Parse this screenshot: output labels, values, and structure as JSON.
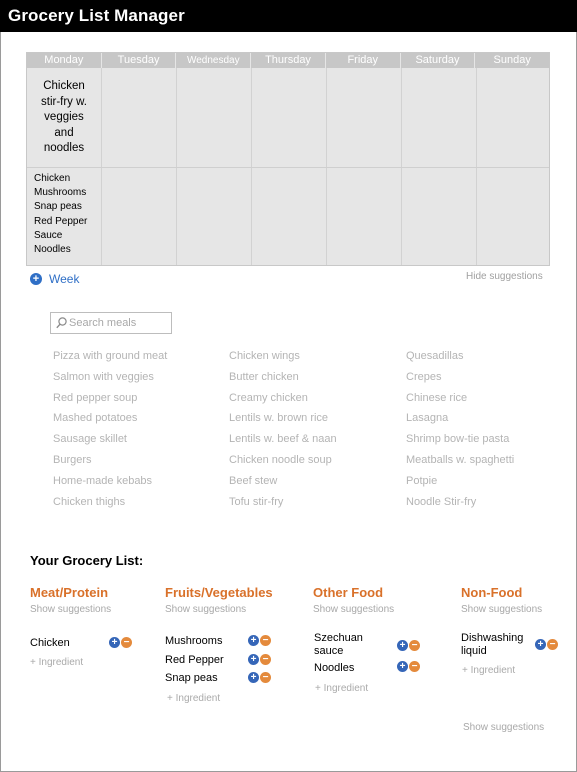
{
  "app": {
    "title": "Grocery List Manager"
  },
  "week": {
    "days": [
      "Monday",
      "Tuesday",
      "Wednesday",
      "Thursday",
      "Friday",
      "Saturday",
      "Sunday"
    ],
    "monday_meal": [
      "Chicken",
      "stir-fry w.",
      "veggies",
      "and",
      "noodles"
    ],
    "monday_ingredients": [
      "Chicken",
      "Mushrooms",
      "Snap peas",
      "Red Pepper",
      "Sauce",
      "Noodles"
    ],
    "add_week_label": "Week",
    "hide_suggestions_label": "Hide suggestions"
  },
  "search": {
    "placeholder": "Search meals"
  },
  "suggestions": {
    "col1": [
      "Pizza with ground meat",
      "Salmon with veggies",
      "Red pepper soup",
      "Mashed potatoes",
      "Sausage skillet",
      "Burgers",
      "Home-made kebabs",
      "Chicken thighs"
    ],
    "col2": [
      "Chicken wings",
      "Butter chicken",
      "Creamy chicken",
      "Lentils w. brown rice",
      "Lentils w. beef & naan",
      "Chicken noodle soup",
      "Beef stew",
      "Tofu stir-fry"
    ],
    "col3": [
      "Quesadillas",
      "Crepes",
      "Chinese rice",
      "Lasagna",
      "Shrimp bow-tie pasta",
      "Meatballs w. spaghetti",
      "Potpie",
      "Noodle Stir-fry"
    ]
  },
  "grocery": {
    "title": "Your Grocery List:",
    "show_suggestions": "Show suggestions",
    "add_ingredient": "+ Ingredient",
    "bottom_show_suggestions": "Show suggestions",
    "categories": [
      {
        "name": "Meat/Protein",
        "items": [
          "Chicken"
        ]
      },
      {
        "name": "Fruits/Vegetables",
        "items": [
          "Mushrooms",
          "Red Pepper",
          "Snap peas"
        ]
      },
      {
        "name": "Other Food",
        "items": [
          "Szechuan sauce",
          "Noodles"
        ],
        "item0_lines": [
          "Szechuan",
          "sauce"
        ]
      },
      {
        "name": "Non-Food",
        "items": [
          "Dishwashing liquid"
        ],
        "item0_lines": [
          "Dishwashing",
          "liquid"
        ]
      }
    ],
    "plus_glyph": "+",
    "minus_glyph": "−"
  },
  "colors": {
    "accent_orange": "#d9712a",
    "accent_blue": "#2f6fc6",
    "title_bar": "#000000"
  },
  "icons": {
    "search": "magnifier-icon",
    "add_week": "plus-circle-icon",
    "increment": "plus-circle-icon",
    "decrement": "minus-circle-icon"
  }
}
